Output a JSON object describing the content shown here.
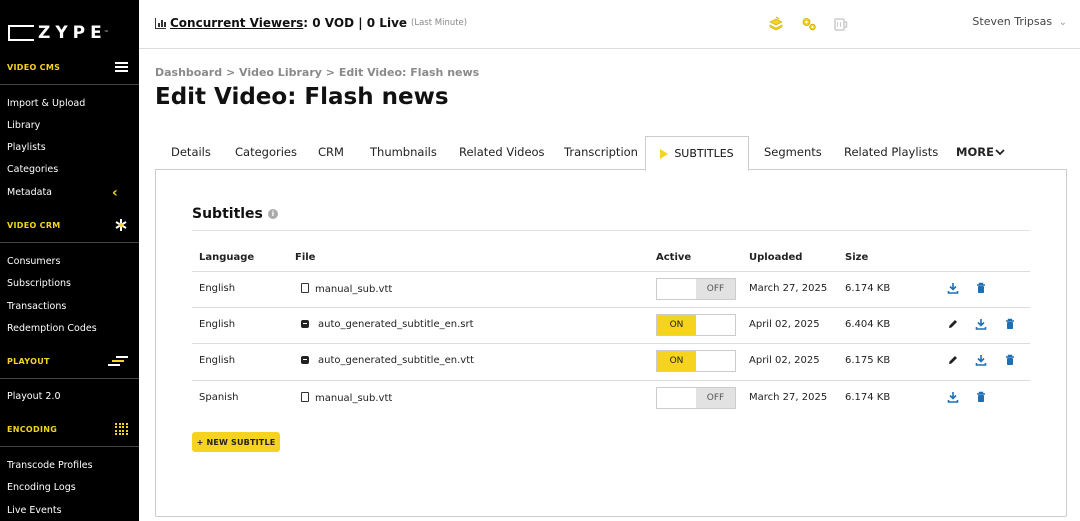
{
  "brand": {
    "name": "ZYPE",
    "tm": "™",
    "accent": "#f5d31e"
  },
  "sidebar": {
    "sections": [
      {
        "label": "VIDEO CMS",
        "items": [
          "Import & Upload",
          "Library",
          "Playlists",
          "Categories",
          "Metadata"
        ]
      },
      {
        "label": "VIDEO CRM",
        "items": [
          "Consumers",
          "Subscriptions",
          "Transactions",
          "Redemption Codes"
        ]
      },
      {
        "label": "PLAYOUT",
        "items": [
          "Playout 2.0"
        ]
      },
      {
        "label": "ENCODING",
        "items": [
          "Transcode Profiles",
          "Encoding Logs",
          "Live Events"
        ]
      }
    ]
  },
  "topbar": {
    "cv_link": "Concurrent Viewers",
    "cv_value": ": 0 VOD | 0 Live",
    "cv_sub": "(Last Minute)",
    "user": "Steven Tripsas",
    "user_chevron": "⌄"
  },
  "breadcrumb": {
    "items": [
      "Dashboard",
      "Video Library",
      "Edit Video: Flash news"
    ],
    "sep": ">"
  },
  "page_title": "Edit Video: Flash news",
  "tabs": [
    "Details",
    "Categories",
    "CRM",
    "Thumbnails",
    "Related Videos",
    "Transcription",
    "SUBTITLES",
    "Segments",
    "Related Playlists",
    "MORE"
  ],
  "active_tab": "SUBTITLES",
  "subtitles": {
    "title": "Subtitles",
    "columns": [
      "Language",
      "File",
      "Active",
      "Uploaded",
      "Size"
    ],
    "rows": [
      {
        "language": "English",
        "file": "manual_sub.vtt",
        "file_type": "manual",
        "active": "OFF",
        "uploaded": "March 27, 2025",
        "size": "6.174 KB",
        "actions": [
          "download",
          "delete"
        ]
      },
      {
        "language": "English",
        "file": "auto_generated_subtitle_en.srt",
        "file_type": "auto",
        "active": "ON",
        "uploaded": "April 02, 2025",
        "size": "6.404 KB",
        "actions": [
          "edit",
          "download",
          "delete"
        ]
      },
      {
        "language": "English",
        "file": "auto_generated_subtitle_en.vtt",
        "file_type": "auto",
        "active": "ON",
        "uploaded": "April 02, 2025",
        "size": "6.175 KB",
        "actions": [
          "edit",
          "download",
          "delete"
        ]
      },
      {
        "language": "Spanish",
        "file": "manual_sub.vtt",
        "file_type": "manual",
        "active": "OFF",
        "uploaded": "March 27, 2025",
        "size": "6.174 KB",
        "actions": [
          "download",
          "delete"
        ]
      }
    ],
    "new_button": "+ NEW SUBTITLE",
    "on_label": "ON",
    "off_label": "OFF"
  }
}
